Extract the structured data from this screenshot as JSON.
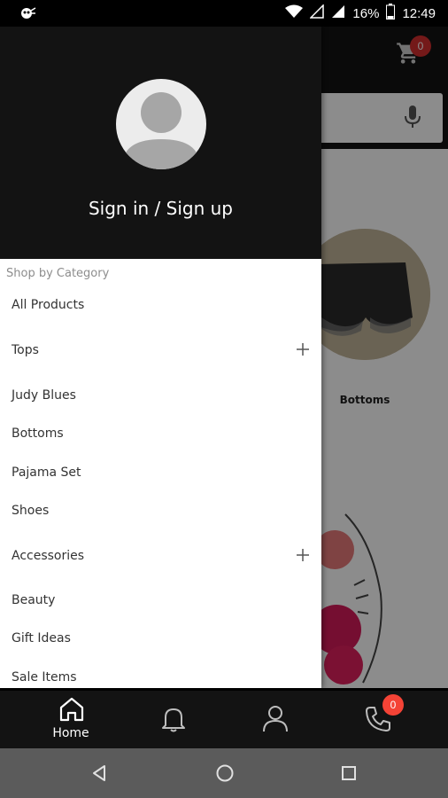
{
  "status_bar": {
    "battery_percent": "16%",
    "time": "12:49"
  },
  "app": {
    "cart_count": "0",
    "category_label": "Bottoms"
  },
  "drawer": {
    "sign_in_label": "Sign in / Sign up",
    "section_title": "Shop by Category",
    "items": [
      {
        "label": "All Products",
        "expandable": false
      },
      {
        "label": "Tops",
        "expandable": true
      },
      {
        "label": "Judy Blues",
        "expandable": false
      },
      {
        "label": "Bottoms",
        "expandable": false
      },
      {
        "label": "Pajama Set",
        "expandable": false
      },
      {
        "label": "Shoes",
        "expandable": false
      },
      {
        "label": "Accessories",
        "expandable": true
      },
      {
        "label": "Beauty",
        "expandable": false
      },
      {
        "label": "Gift Ideas",
        "expandable": false
      },
      {
        "label": "Sale Items",
        "expandable": false
      }
    ]
  },
  "bottom_nav": {
    "items": [
      {
        "icon": "home-icon",
        "label": "Home",
        "active": true
      },
      {
        "icon": "bell-icon",
        "label": "",
        "active": false
      },
      {
        "icon": "user-icon",
        "label": "",
        "active": false
      },
      {
        "icon": "phone-icon",
        "label": "",
        "active": false
      }
    ],
    "phone_badge": "0"
  },
  "system_nav": {
    "items": [
      "back-icon",
      "home-circle-icon",
      "recents-icon"
    ]
  },
  "colors": {
    "header_bg": "#131313",
    "badge_red": "#d32f2f",
    "system_nav_bg": "#5b5b5b"
  }
}
